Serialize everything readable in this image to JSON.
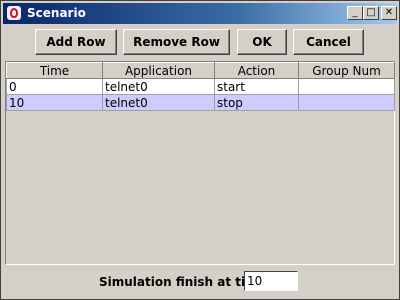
{
  "window": {
    "title": "Scenario",
    "minimize_symbol": "_",
    "maximize_symbol": "□",
    "close_symbol": "✕"
  },
  "toolbar": {
    "add_row": "Add Row",
    "remove_row": "Remove Row",
    "ok": "OK",
    "cancel": "Cancel"
  },
  "table": {
    "columns": [
      "Time",
      "Application",
      "Action",
      "Group Num"
    ],
    "rows": [
      {
        "time": "0",
        "application": "telnet0",
        "action": "start",
        "group_num": ""
      },
      {
        "time": "10",
        "application": "telnet0",
        "action": "stop",
        "group_num": ""
      }
    ],
    "selected_row": 1
  },
  "footer": {
    "label": "Simulation finish at time",
    "finish_time": "10"
  },
  "colors": {
    "selection": "#ccccff",
    "title_start": "#0a246a",
    "title_end": "#a6caf0",
    "face": "#d4d0c8"
  }
}
